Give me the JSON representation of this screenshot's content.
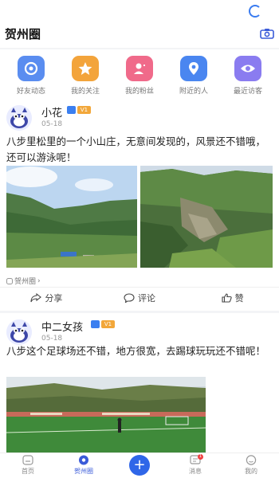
{
  "header": {
    "title": "贺州圈"
  },
  "quick_links": [
    {
      "label": "好友动态",
      "icon": "friends-feed-icon",
      "color": "#5a8df0"
    },
    {
      "label": "我的关注",
      "icon": "star-icon",
      "color": "#f3a43b"
    },
    {
      "label": "我的粉丝",
      "icon": "fans-icon",
      "color": "#f06a8a"
    },
    {
      "label": "附近的人",
      "icon": "location-icon",
      "color": "#4a86f0"
    },
    {
      "label": "最近访客",
      "icon": "eye-icon",
      "color": "#8a7cf0"
    }
  ],
  "posts": [
    {
      "name": "小花",
      "date": "05-18",
      "content": "八步里松里的一个小山庄，无意间发现的，风景还不错哦，还可以游泳呢！",
      "tag": "贺州圈",
      "level": "V1"
    },
    {
      "name": "中二女孩",
      "date": "05-18",
      "content": "八步这个足球场还不错，地方很宽，去踢球玩玩还不错呢！",
      "level": "V1"
    }
  ],
  "actions": {
    "share": "分享",
    "comment": "评论",
    "like": "赞"
  },
  "tabbar": {
    "items": [
      {
        "label": "首页"
      },
      {
        "label": "贺州圈"
      },
      {
        "label": ""
      },
      {
        "label": "消息",
        "badge": "1"
      },
      {
        "label": "我的"
      }
    ]
  }
}
